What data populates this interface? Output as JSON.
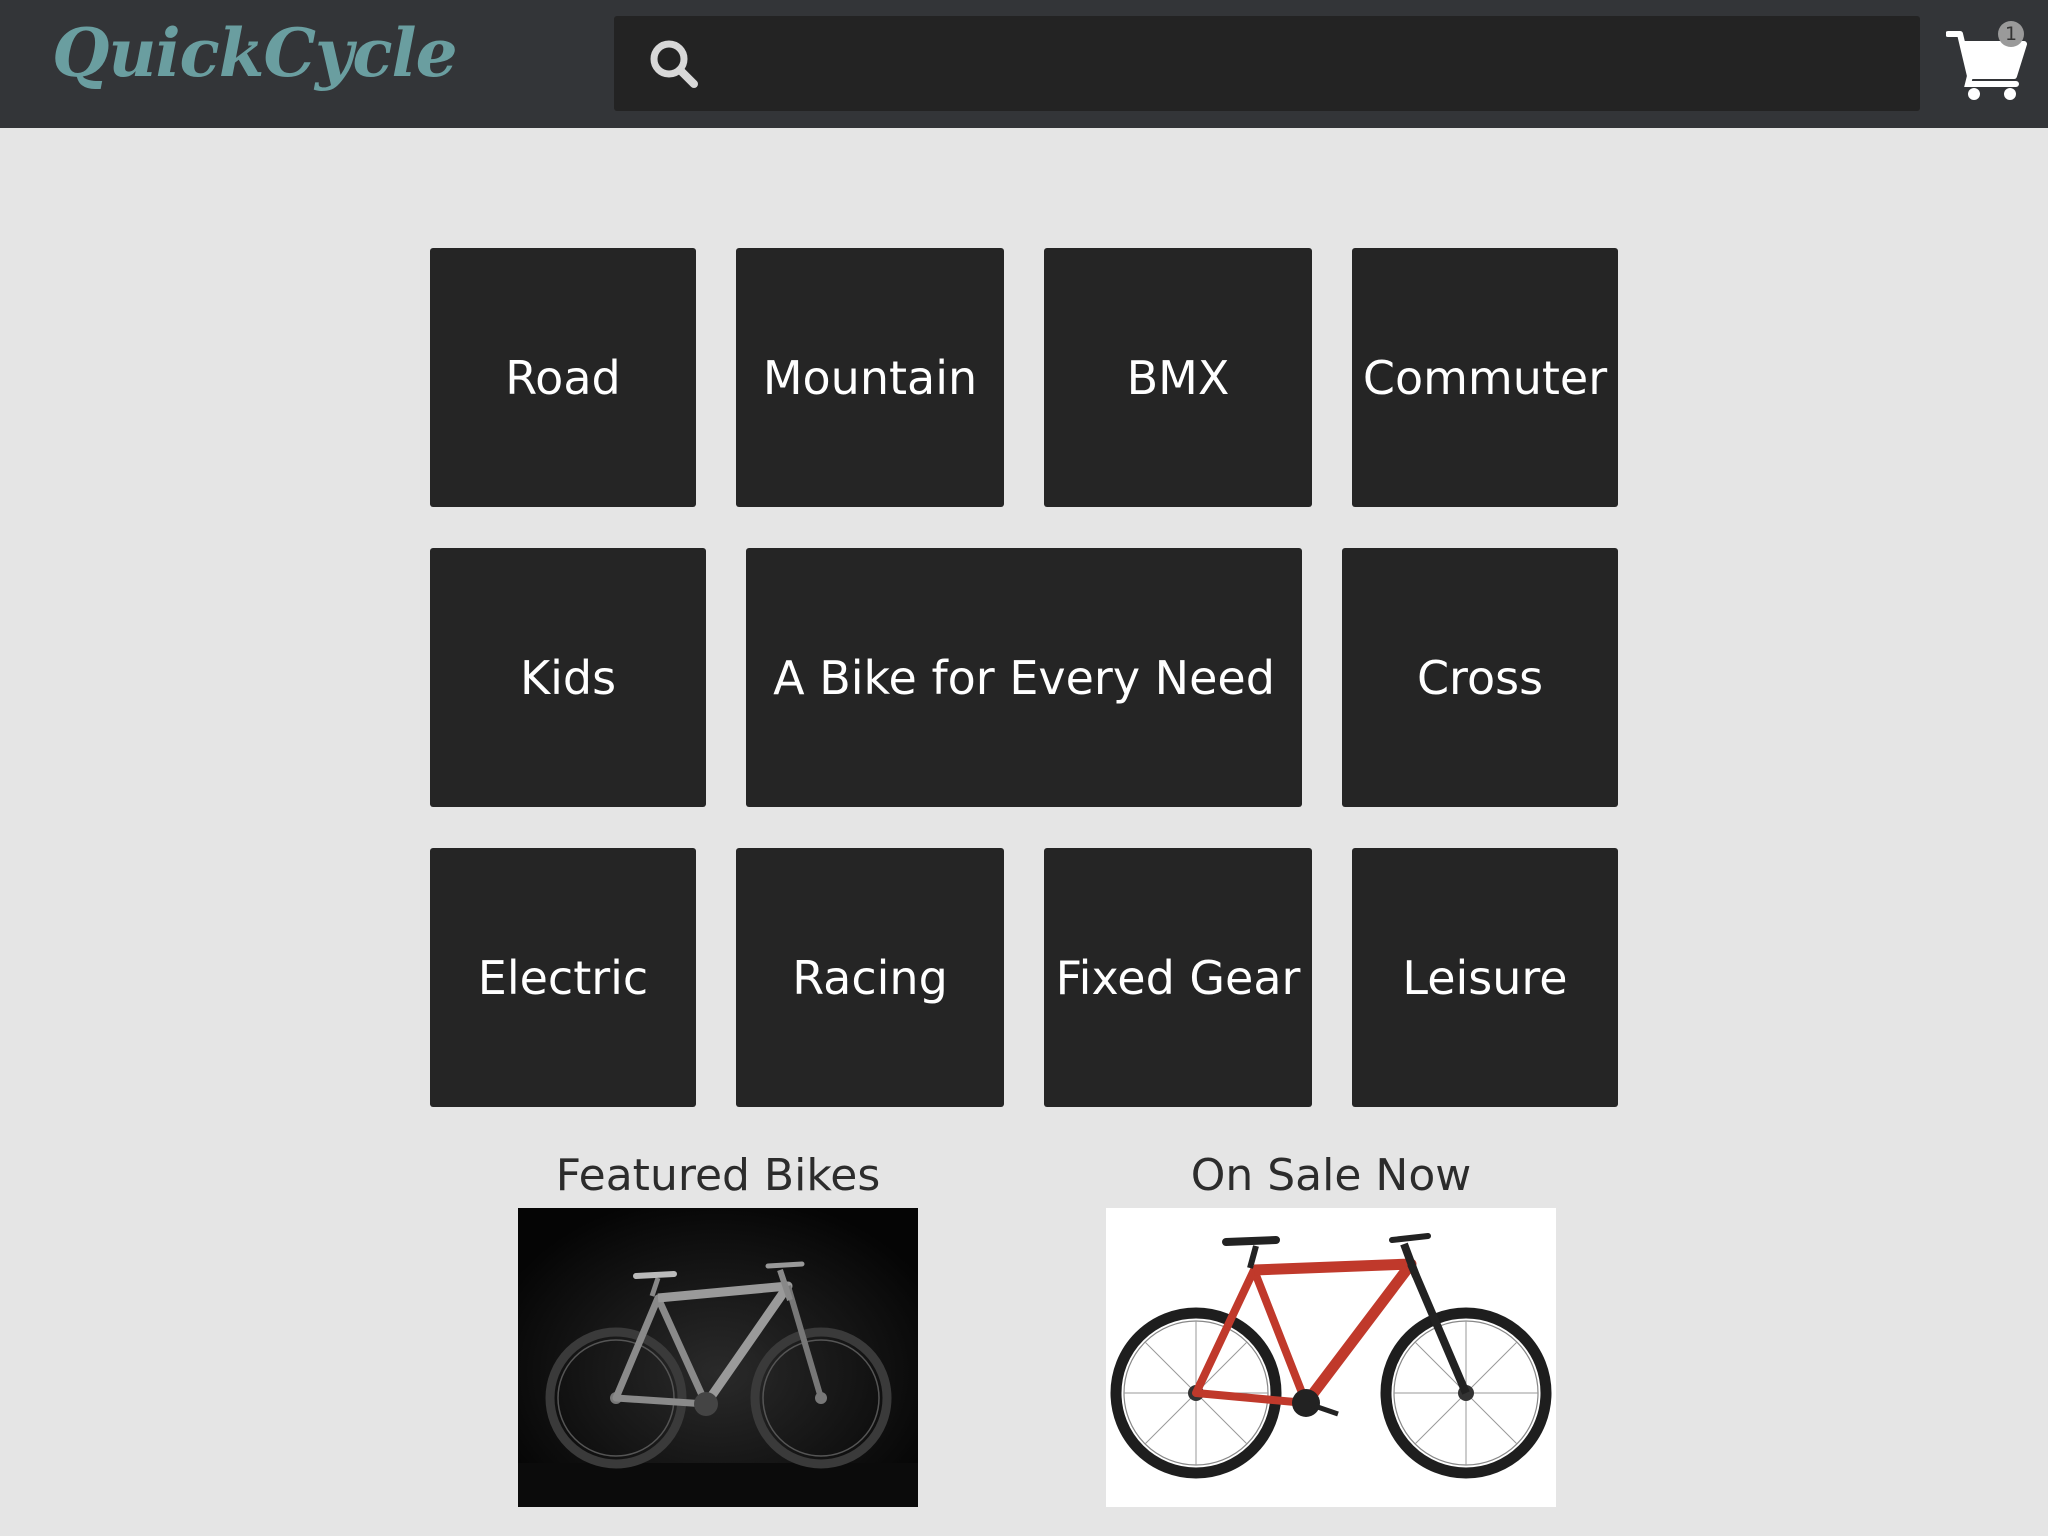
{
  "header": {
    "logo": "QuickCycle",
    "search": {
      "value": "",
      "placeholder": ""
    },
    "cart": {
      "count": "1"
    }
  },
  "categories": {
    "road": "Road",
    "mountain": "Mountain",
    "bmx": "BMX",
    "commuter": "Commuter",
    "kids": "Kids",
    "every_need": "A Bike for Every Need",
    "cross": "Cross",
    "electric": "Electric",
    "racing": "Racing",
    "fixed_gear": "Fixed Gear",
    "leisure": "Leisure"
  },
  "featured": {
    "title": "Featured Bikes"
  },
  "sale": {
    "title": "On Sale Now"
  },
  "colors": {
    "header_bg": "#333538",
    "logo": "#6a9ea0",
    "tile_bg": "#252525",
    "page_bg": "#e5e5e5",
    "sale_bike_frame": "#c0392b"
  },
  "icons": {
    "search": "search-icon",
    "cart": "cart-icon"
  }
}
